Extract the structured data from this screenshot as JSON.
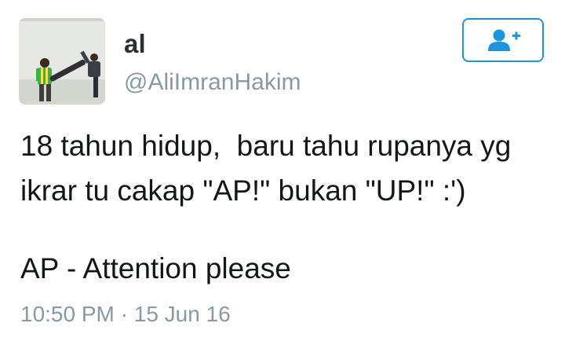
{
  "user": {
    "display_name": "al",
    "handle": "@AliImranHakim",
    "avatar_icon": "profile-photo"
  },
  "follow_button": {
    "icon": "add-user-icon",
    "color": "#1b95e0"
  },
  "tweet": {
    "line1": "18 tahun hidup,  baru tahu rupanya yg",
    "line2": "ikrar tu cakap \"AP!\" bukan \"UP!\" :')",
    "line3": "AP - Attention please",
    "time": "10:50 PM",
    "separator": "·",
    "date": "15 Jun 16"
  }
}
